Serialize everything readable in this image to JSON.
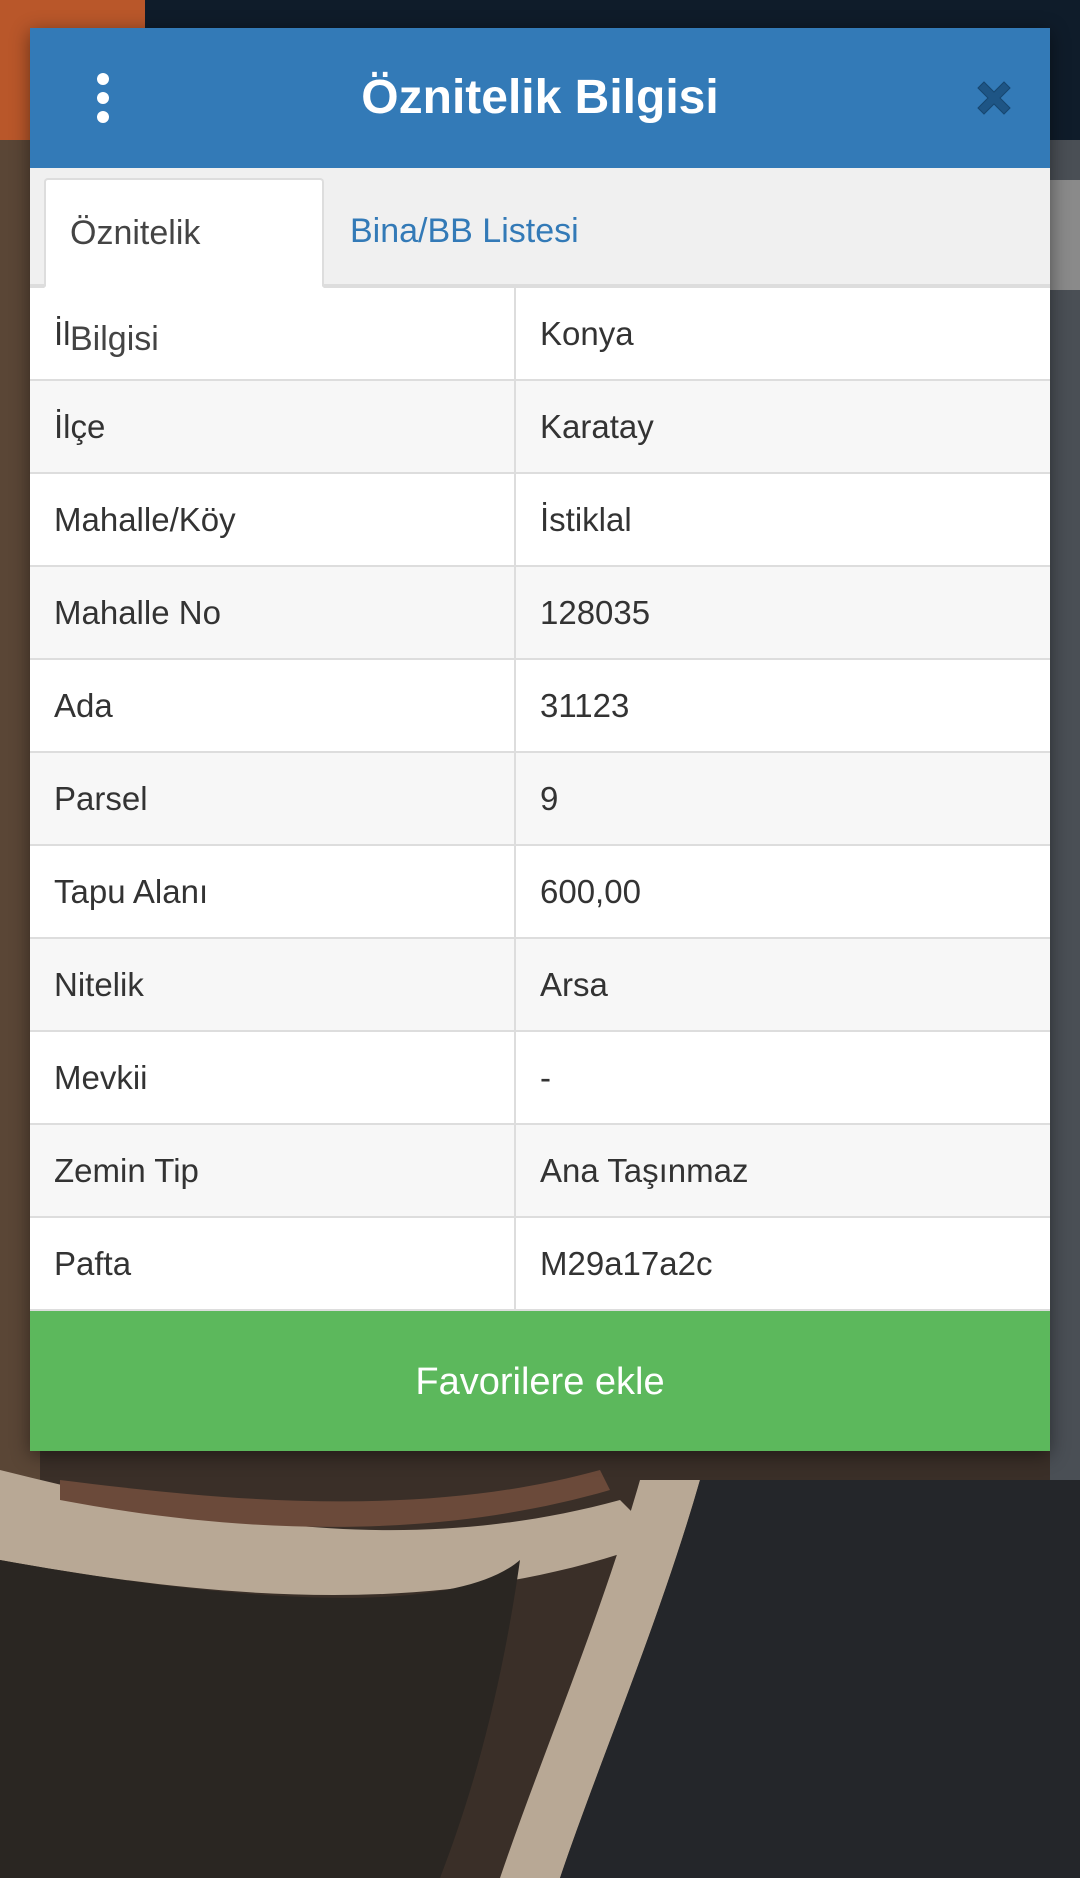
{
  "header": {
    "title": "Öznitelik Bilgisi",
    "menu_icon": "kebab-menu-icon",
    "close_icon": "close-x-icon",
    "color": "#337ab7"
  },
  "tabs": [
    {
      "label": "Öznitelik Bilgisi",
      "active": true
    },
    {
      "label": "Bina/BB Listesi",
      "active": false
    }
  ],
  "attributes": [
    {
      "key": "İl",
      "value": "Konya"
    },
    {
      "key": "İlçe",
      "value": "Karatay"
    },
    {
      "key": "Mahalle/Köy",
      "value": "İstiklal"
    },
    {
      "key": "Mahalle No",
      "value": "128035"
    },
    {
      "key": "Ada",
      "value": "31123"
    },
    {
      "key": "Parsel",
      "value": "9"
    },
    {
      "key": "Tapu Alanı",
      "value": "600,00"
    },
    {
      "key": "Nitelik",
      "value": "Arsa"
    },
    {
      "key": "Mevkii",
      "value": "-"
    },
    {
      "key": "Zemin Tip",
      "value": "Ana Taşınmaz"
    },
    {
      "key": "Pafta",
      "value": "M29a17a2c"
    }
  ],
  "footer": {
    "favorite_label": "Favorilere ekle",
    "color": "#5cb85c"
  }
}
